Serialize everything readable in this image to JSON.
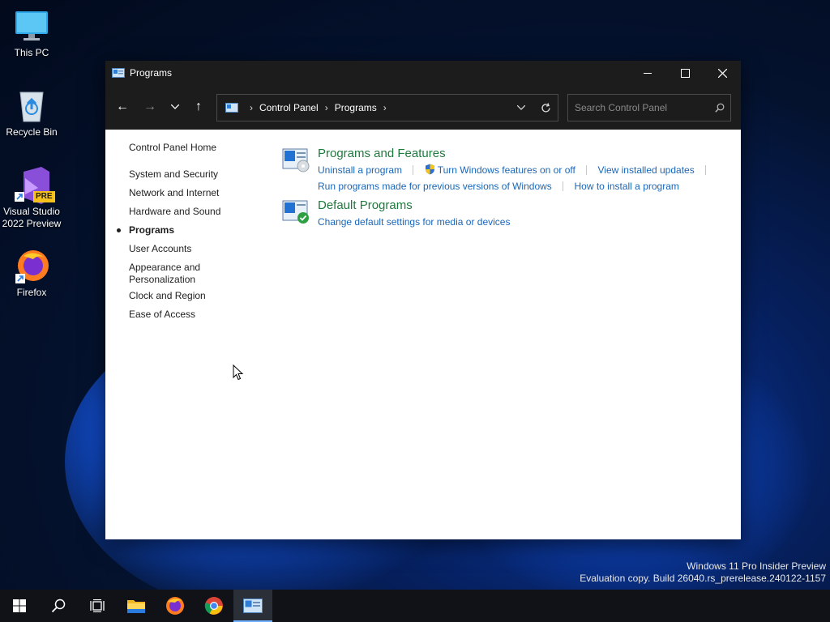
{
  "desktop": {
    "icons": [
      {
        "label": "This PC"
      },
      {
        "label": "Recycle Bin"
      },
      {
        "label": "Visual Studio 2022 Preview"
      },
      {
        "label": "Firefox"
      }
    ],
    "badge_pre": "PRE"
  },
  "window": {
    "title": "Programs",
    "controls": {
      "minimize": "—",
      "maximize": "☐",
      "close": "✕"
    }
  },
  "toolbar": {
    "back": "←",
    "forward": "→",
    "recent": "⌄",
    "up": "↑",
    "breadcrumb": [
      "Control Panel",
      "Programs"
    ],
    "search_placeholder": "Search Control Panel"
  },
  "leftnav": {
    "home": "Control Panel Home",
    "items": [
      {
        "label": "System and Security"
      },
      {
        "label": "Network and Internet"
      },
      {
        "label": "Hardware and Sound"
      },
      {
        "label": "Programs",
        "current": true
      },
      {
        "label": "User Accounts"
      },
      {
        "label": "Appearance and Personalization",
        "line1": "Appearance and",
        "line2": "Personalization"
      },
      {
        "label": "Clock and Region"
      },
      {
        "label": "Ease of Access"
      }
    ]
  },
  "main": {
    "programs_features": {
      "title": "Programs and Features",
      "links": [
        "Uninstall a program",
        "Turn Windows features on or off",
        "View installed updates",
        "Run programs made for previous versions of Windows",
        "How to install a program"
      ]
    },
    "default_programs": {
      "title": "Default Programs",
      "links": [
        "Change default settings for media or devices"
      ]
    }
  },
  "watermark": {
    "line1": "Windows 11 Pro Insider Preview",
    "line2": "Evaluation copy. Build 26040.rs_prerelease.240122-1157"
  },
  "colors": {
    "link": "#1a66b8",
    "section_title": "#1e7a3e",
    "titlebar": "#1c1c1c"
  },
  "taskbar": {
    "items": [
      "start-icon",
      "search-icon",
      "task-view-icon",
      "file-explorer-icon",
      "firefox-icon",
      "chrome-icon",
      "control-panel-icon"
    ]
  }
}
